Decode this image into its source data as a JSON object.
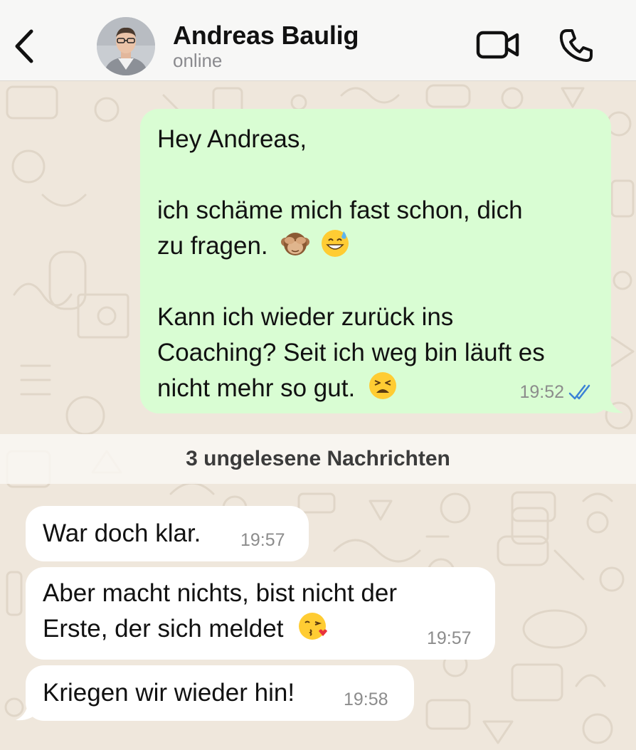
{
  "header": {
    "contact_name": "Andreas Baulig",
    "status": "online",
    "icons": {
      "back": "chevron-left-icon",
      "video": "video-camera-icon",
      "call": "phone-icon"
    }
  },
  "messages": {
    "sent": {
      "lines": [
        "Hey Andreas,",
        "",
        "ich schäme mich fast schon, dich",
        "zu fragen.",
        "",
        "Kann ich wieder zurück ins",
        "Coaching? Seit ich weg bin läuft es",
        "nicht mehr so gut."
      ],
      "emojis": [
        "see-no-evil-monkey-emoji",
        "grinning-sweat-emoji",
        "weary-face-emoji"
      ],
      "time": "19:52",
      "status": "read-double-check-icon"
    },
    "unread_divider": "3 ungelesene Nachrichten",
    "received": [
      {
        "lines": [
          "War doch klar."
        ],
        "time": "19:57"
      },
      {
        "lines": [
          "Aber macht nichts, bist nicht der",
          "Erste, der sich meldet"
        ],
        "emoji": "face-blowing-kiss-emoji",
        "time": "19:57"
      },
      {
        "lines": [
          "Kriegen wir wieder hin!"
        ],
        "time": "19:58"
      }
    ]
  },
  "colors": {
    "header_bg": "#f7f7f6",
    "chat_bg": "#efe7dc",
    "outgoing_bubble": "#d9fdd3",
    "incoming_bubble": "#ffffff",
    "read_ticks": "#3b82d6"
  }
}
